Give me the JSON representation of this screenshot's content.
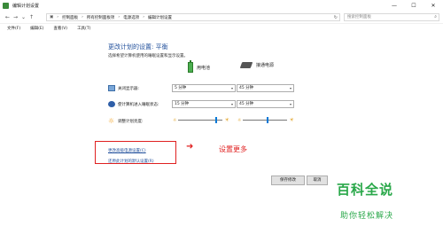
{
  "window": {
    "title": "编辑计划设置",
    "minimize": "—",
    "maximize": "☐",
    "close": "✕"
  },
  "address": {
    "crumbs": [
      "控制面板",
      "所有控制面板项",
      "电源选项",
      "编辑计划设置"
    ],
    "separator": "›",
    "search_placeholder": "搜索控制面板"
  },
  "menu": [
    "文件(F)",
    "编辑(E)",
    "查看(V)",
    "工具(T)"
  ],
  "main": {
    "heading": "更改计划的设置: 平衡",
    "subheading": "选择希望计算机使用的睡眠设置和显示设置。",
    "col_battery": "用电池",
    "col_plugged": "接通电源",
    "rows": [
      {
        "label": "关闭显示器:",
        "battery": "5 分钟",
        "plugged": "45 分钟"
      },
      {
        "label": "使计算机进入睡眠状态:",
        "battery": "15 分钟",
        "plugged": "45 分钟"
      },
      {
        "label": "调整计划亮度:"
      }
    ],
    "brightness_battery": 0.85,
    "brightness_plugged": 0.55,
    "link_advanced": "更改高级电源设置(C)",
    "link_restore": "还原此计划的默认设置(R)",
    "save_button": "保存修改",
    "cancel_button": "取消"
  },
  "annotation": {
    "arrow": "➜",
    "text": "设置更多",
    "color": "#e02020"
  },
  "watermark": {
    "title": "百科全说",
    "subtitle": "助你轻松解决",
    "color": "#2aa84a"
  }
}
